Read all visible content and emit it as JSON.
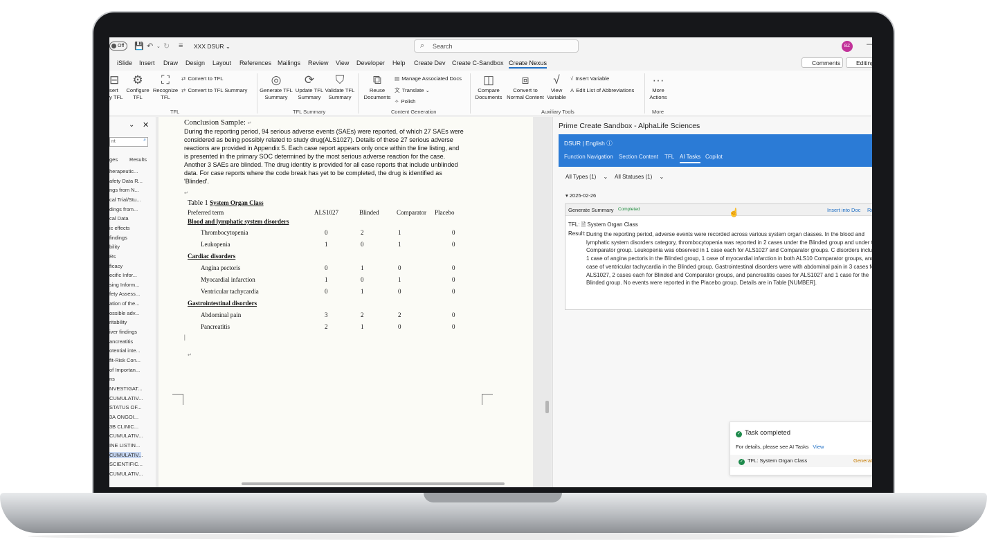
{
  "titlebar": {
    "toggle": "Off",
    "doc_title": "XXX DSUR",
    "search_placeholder": "Search",
    "avatar": "BZ"
  },
  "menu": {
    "tabs": [
      "iSlide",
      "Insert",
      "Draw",
      "Design",
      "Layout",
      "References",
      "Mailings",
      "Review",
      "View",
      "Developer",
      "Help",
      "Create Dev",
      "Create C-Sandbox",
      "Create Nexus"
    ],
    "comments": "Comments",
    "editing": "Editing"
  },
  "ribbon": {
    "insert_tfl": "sert\ny TFL",
    "configure_tfl": "Configure\nTFL",
    "recognize_tfl": "Recognize\nTFL",
    "convert_tfl": "Convert to TFL",
    "convert_tfl_summary": "Convert to TFL Summary",
    "group_tfl": "TFL",
    "generate_summary": "Generate TFL\nSummary",
    "update_summary": "Update TFL\nSummary",
    "validate_summary": "Validate TFL\nSummary",
    "group_tfl_summary": "TFL Summary",
    "reuse_documents": "Reuse\nDocuments",
    "manage_associated": "Manage Associated Docs",
    "translate": "Translate",
    "polish": "Polish",
    "group_content_gen": "Content Generation",
    "compare_documents": "Compare\nDocuments",
    "convert_normal": "Convert to\nNormal Content",
    "view_variable": "View\nVariable",
    "insert_variable": "Insert Variable",
    "edit_abbrev": "Edit List of Abbreviations",
    "group_aux": "Auxiliary Tools",
    "more_actions": "More\nActions",
    "group_more": "More"
  },
  "nav": {
    "search": "nt",
    "tab_pages": "ges",
    "tab_results": "Results",
    "items": [
      "herapeutic...",
      "afety Data R...",
      "ngs from N...",
      "cal Trial/Stu...",
      "dings from...",
      "cal Data",
      "ic effects",
      "findings",
      "bility",
      "Rs",
      "ficacy",
      "ecific Infor...",
      "sing Inform...",
      "fety Assess...",
      "ation of the...",
      "ossible adv...",
      "ritability",
      "iver findings",
      "ancreatitis",
      "otential inte...",
      "fit-Risk Con...",
      "of Importan...",
      "ns",
      "NVESTIGAT...",
      "CUMULATIV...",
      "STATUS OF...",
      "3A ONGOI...",
      "3B CLINIC...",
      "CUMULATIV...",
      "INE LISTIN...",
      "CUMULATIV...",
      "SCIENTIFIC...",
      "CUMULATIV..."
    ]
  },
  "document": {
    "conclusion_title": "Conclusion Sample:",
    "paragraph_lines": [
      "During the reporting period, 94 serious adverse events (SAEs) were reported, of which 27 SAEs were",
      "considered as being possibly related to study drug(ALS1027). Details of these 27 serious adverse",
      "reactions are provided in Appendix 5. Each case report appears only once within the line listing, and",
      "is presented in the primary SOC determined by the most serious adverse reaction for the case.",
      "Another 3 SAEs are blinded. The drug identity is provided for all case reports that include unblinded",
      "data. For case reports where the code break has yet to be completed, the drug is identified as",
      "'Blinded'."
    ],
    "table_caption_prefix": "Table 1",
    "table_caption_link": "System Organ Class",
    "columns": [
      "Preferred term",
      "ALS1027",
      "Blinded",
      "Comparator",
      "Placebo"
    ],
    "rows": [
      {
        "type": "soc",
        "term": "Blood and lymphatic system disorders",
        "values": [
          "",
          "",
          "",
          ""
        ]
      },
      {
        "type": "pt",
        "term": "Thrombocytopenia",
        "values": [
          "0",
          "2",
          "1",
          "0"
        ]
      },
      {
        "type": "pt",
        "term": "Leukopenia",
        "values": [
          "1",
          "0",
          "1",
          "0"
        ]
      },
      {
        "type": "soc",
        "term": "Cardiac disorders",
        "values": [
          "",
          "",
          "",
          ""
        ]
      },
      {
        "type": "pt",
        "term": "Angina pectoris",
        "values": [
          "0",
          "1",
          "0",
          "0"
        ]
      },
      {
        "type": "pt",
        "term": "Myocardial infarction",
        "values": [
          "1",
          "0",
          "1",
          "0"
        ]
      },
      {
        "type": "pt",
        "term": "Ventricular tachycardia",
        "values": [
          "0",
          "1",
          "0",
          "0"
        ]
      },
      {
        "type": "soc",
        "term": "Gastrointestinal disorders",
        "values": [
          "",
          "",
          "",
          ""
        ]
      },
      {
        "type": "pt",
        "term": "Abdominal pain",
        "values": [
          "3",
          "2",
          "2",
          "0"
        ]
      },
      {
        "type": "pt",
        "term": "Pancreatitis",
        "values": [
          "2",
          "1",
          "0",
          "0"
        ]
      }
    ]
  },
  "panel": {
    "title": "Prime Create Sandbox - AlphaLife Sciences",
    "header": "DSUR | English",
    "tabs": [
      "Function Navigation",
      "Section Content",
      "TFL",
      "AI Tasks",
      "Copilot"
    ],
    "filter_types": "All Types (1)",
    "filter_statuses": "All Statuses (1)",
    "date": "2025-02-26",
    "card": {
      "title": "Generate Summary",
      "status": "Completed",
      "insert": "Insert into Doc",
      "re": "Re",
      "tfl_label": "TFL:",
      "tfl_value": "System Organ Class",
      "result_label": "Result:",
      "result_text": "During the reporting period, adverse events were recorded across various system organ classes. In the blood and lymphatic system disorders category, thrombocytopenia was reported in 2 cases under the Blinded group and under the Comparator group. Leukopenia was observed in 1 case each for ALS1027 and Comparator groups. C disorders included 1 case of angina pectoris in the Blinded group, 1 case of myocardial infarction in both ALS10 Comparator groups, and 1 case of ventricular tachycardia in the Blinded group. Gastrointestinal disorders were with abdominal pain in 3 cases for ALS1027, 2 cases each for Blinded and Comparator groups, and pancreatitis cases for ALS1027 and 1 case for the Blinded group. No events were reported in the Placebo group. Details are in Table [NUMBER]."
    }
  },
  "toast": {
    "title": "Task completed",
    "details": "For details, please see AI Tasks",
    "view": "View",
    "item": "TFL: System Organ Class",
    "item_status": "Generat"
  },
  "colors": {
    "accent": "#2b7bd6",
    "active_tab": "#1f6fc5",
    "completed": "#1e8a4c"
  }
}
